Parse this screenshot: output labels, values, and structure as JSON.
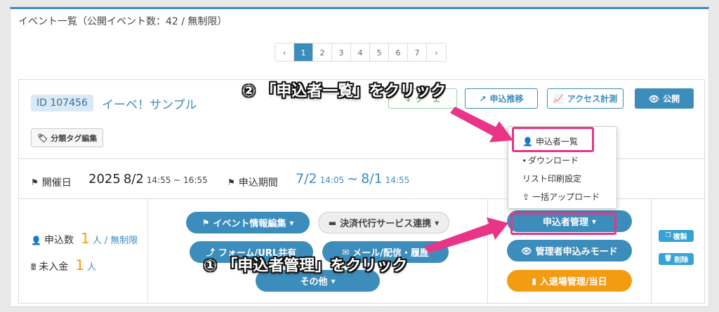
{
  "header": {
    "title": "イベント一覧（公開イベント数：42 / 無制限）"
  },
  "pagination": {
    "prev": "‹",
    "pages": [
      "1",
      "2",
      "3",
      "4",
      "5",
      "6",
      "7"
    ],
    "next": "›",
    "active": "1"
  },
  "event": {
    "id": "ID 107456",
    "name": "イーベ！サンプル",
    "tag_button": "分類タグ編集",
    "toolbar": {
      "button1": "グ　ェ",
      "button2": "申込推移",
      "button3": "アクセス計測",
      "publish": "公開"
    },
    "dates": {
      "event_label": "開催日",
      "year": "2025",
      "date": "8/2",
      "time": "14:55 ~ 16:55",
      "apply_label": "申込期間",
      "apply_start": "7/2",
      "apply_start_time": "14:05",
      "tilde": "~",
      "apply_end": "8/1",
      "apply_end_time": "14:55"
    },
    "stats": {
      "applicants_label": "申込数",
      "applicants_value": "1",
      "applicants_unit": "人",
      "applicants_limit": "/ 無制限",
      "unpaid_label": "未入金",
      "unpaid_value": "1",
      "unpaid_unit": "人"
    },
    "actions": {
      "edit": "イベント情報編集",
      "payment": "決済代行サービス連携",
      "form": "フォーム/URL共有",
      "mail": "メール/配信・履歴",
      "other": "その他"
    },
    "applicant_mgmt": {
      "button": "申込者管理",
      "admin_mode": "管理者申込みモード",
      "entry": "入退場管理/当日"
    },
    "side": {
      "copy": "複製",
      "delete": "削除"
    }
  },
  "dropdown": {
    "items": [
      "申込者一覧",
      "ダウンロード",
      "リスト印刷設定",
      "一括アップロード"
    ]
  },
  "annotations": {
    "step2": "② 「申込者一覧」をクリック",
    "step1": "① 「申込者管理」をクリック"
  },
  "colors": {
    "accent": "#3c8dbc",
    "highlight": "#e93586",
    "orange": "#f39c12"
  }
}
